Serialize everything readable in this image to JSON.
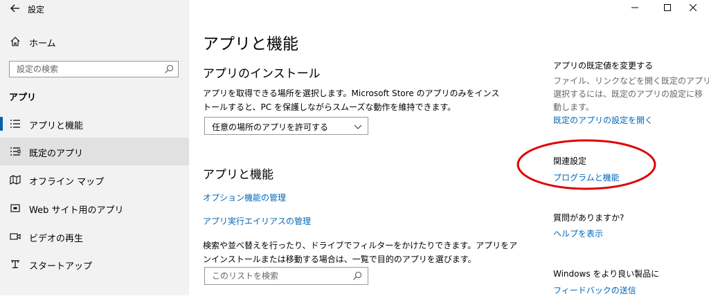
{
  "window": {
    "title": "設定"
  },
  "sidebar": {
    "home_label": "ホーム",
    "search_placeholder": "設定の検索",
    "section_label": "アプリ",
    "items": [
      {
        "label": "アプリと機能",
        "icon": "apps-features-icon"
      },
      {
        "label": "既定のアプリ",
        "icon": "default-apps-icon"
      },
      {
        "label": "オフライン マップ",
        "icon": "offline-maps-icon"
      },
      {
        "label": "Web サイト用のアプリ",
        "icon": "websites-apps-icon"
      },
      {
        "label": "ビデオの再生",
        "icon": "video-playback-icon"
      },
      {
        "label": "スタートアップ",
        "icon": "startup-icon"
      }
    ]
  },
  "main": {
    "page_title": "アプリと機能",
    "install_heading": "アプリのインストール",
    "install_desc_line1": "アプリを取得できる場所を選択します。Microsoft Store のアプリのみをインス",
    "install_desc_line2": "トールすると、PC を保護しながらスムーズな動作を維持できます。",
    "install_dropdown_value": "任意の場所のアプリを許可する",
    "apps_heading": "アプリと機能",
    "optional_features_link": "オプション機能の管理",
    "app_alias_link": "アプリ実行エイリアスの管理",
    "apps_desc_line1": "検索や並べ替えを行ったり、ドライブでフィルターをかけたりできます。アプリをア",
    "apps_desc_line2": "ンインストールまたは移動する場合は、一覧で目的のアプリを選びます。",
    "list_search_placeholder": "このリストを検索"
  },
  "right": {
    "defaults_heading": "アプリの既定値を変更する",
    "defaults_desc_line1": "ファイル、リンクなどを開く既定のアプリを",
    "defaults_desc_line2": "選択するには、既定のアプリの設定に移",
    "defaults_desc_line3": "動します。",
    "defaults_link": "既定のアプリの設定を開く",
    "related_heading": "関連設定",
    "related_link": "プログラムと機能",
    "question_heading": "質問がありますか?",
    "help_link": "ヘルプを表示",
    "feedback_heading": "Windows をより良い製品に",
    "feedback_link": "フィードバックの送信"
  },
  "colors": {
    "accent": "#0063b1",
    "link": "#0067b8",
    "annotation": "#e00000",
    "sidebar_bg": "#f2f2f2",
    "selected_bg": "#e1e1e1"
  }
}
